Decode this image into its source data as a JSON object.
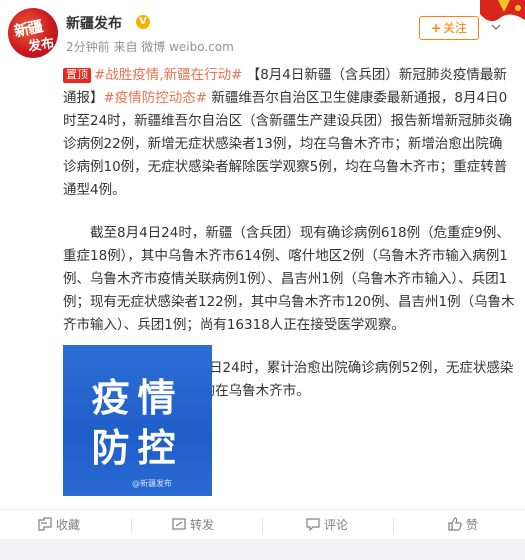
{
  "post": {
    "author": "新疆发布",
    "avatar_text_1": "新疆",
    "avatar_text_2": "发布",
    "verified_badge": "V",
    "meta": "2分钟前 来自 微博 weibo.com",
    "follow_label": "关注",
    "follow_plus": "+"
  },
  "content": {
    "top_tag": "置顶",
    "hashtag_1": "#战胜疫情,新疆在行动#",
    "title": "【8月4日新疆（含兵团）新冠肺炎疫情最新通报】",
    "hashtag_2": "#疫情防控动态#",
    "para1_rest": " 新疆维吾尔自治区卫生健康委最新通报，8月4日0时至24时，新疆维吾尔自治区（含新疆生产建设兵团）报告新增新冠肺炎确诊病例22例，新增无症状感染者13例，均在乌鲁木齐市；新增治愈出院确诊病例10例，无症状感染者解除医学观察5例，均在乌鲁木齐市；重症转普通型4例。",
    "para2": "截至8月4日24时，新疆（含兵团）现有确诊病例618例（危重症9例、重症18例），其中乌鲁木齐市614例、喀什地区2例（乌鲁木齐市输入病例1例、乌鲁木齐市疫情关联病例1例）、昌吉州1例（乌鲁木齐市输入）、兵团1例；现有无症状感染者122例，其中乌鲁木齐市120例、昌吉州1例（乌鲁木齐市输入）、兵团1例；尚有16318人正在接受医学观察。",
    "para3": "7月15日0时至8月4日24时，累计治愈出院确诊病例52例，无症状感染者解除医学观察42例，均在乌鲁木齐市。"
  },
  "image": {
    "line1": "疫情",
    "line2": "防控",
    "watermark": "@新疆发布"
  },
  "footer": {
    "favorite_label": "收藏",
    "repost_label": "转发",
    "comment_label": "评论",
    "like_label": "赞"
  },
  "colors": {
    "link": "#eb7350",
    "follow": "#ff8200",
    "top_tag": "#e5291f",
    "image_bg": "#2563d0"
  }
}
